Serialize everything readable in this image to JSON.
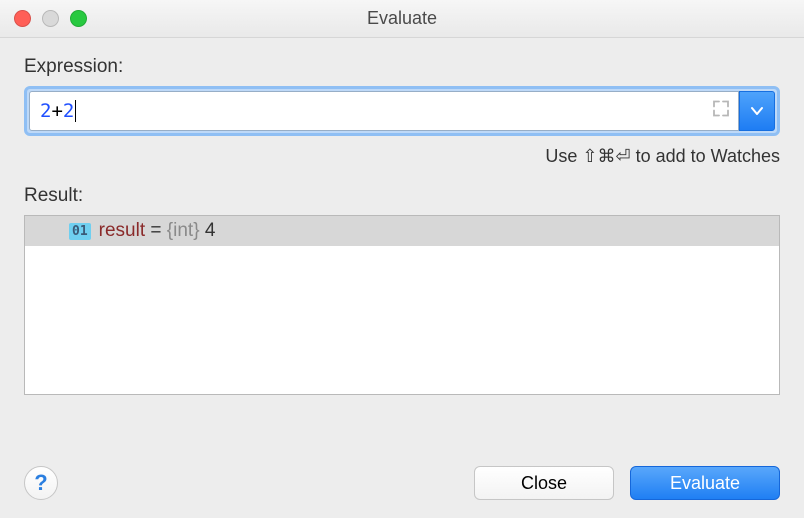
{
  "window": {
    "title": "Evaluate"
  },
  "expression": {
    "label": "Expression:",
    "token_num1": "2",
    "token_op": " + ",
    "token_num2": "2"
  },
  "hint": {
    "prefix": "Use ",
    "keys": "⇧⌘⏎",
    "suffix": " to add to Watches"
  },
  "result": {
    "label": "Result:",
    "badge": "01",
    "name": "result",
    "eq": " = ",
    "type": "{int}",
    "value": " 4"
  },
  "buttons": {
    "help": "?",
    "close": "Close",
    "evaluate": "Evaluate"
  }
}
